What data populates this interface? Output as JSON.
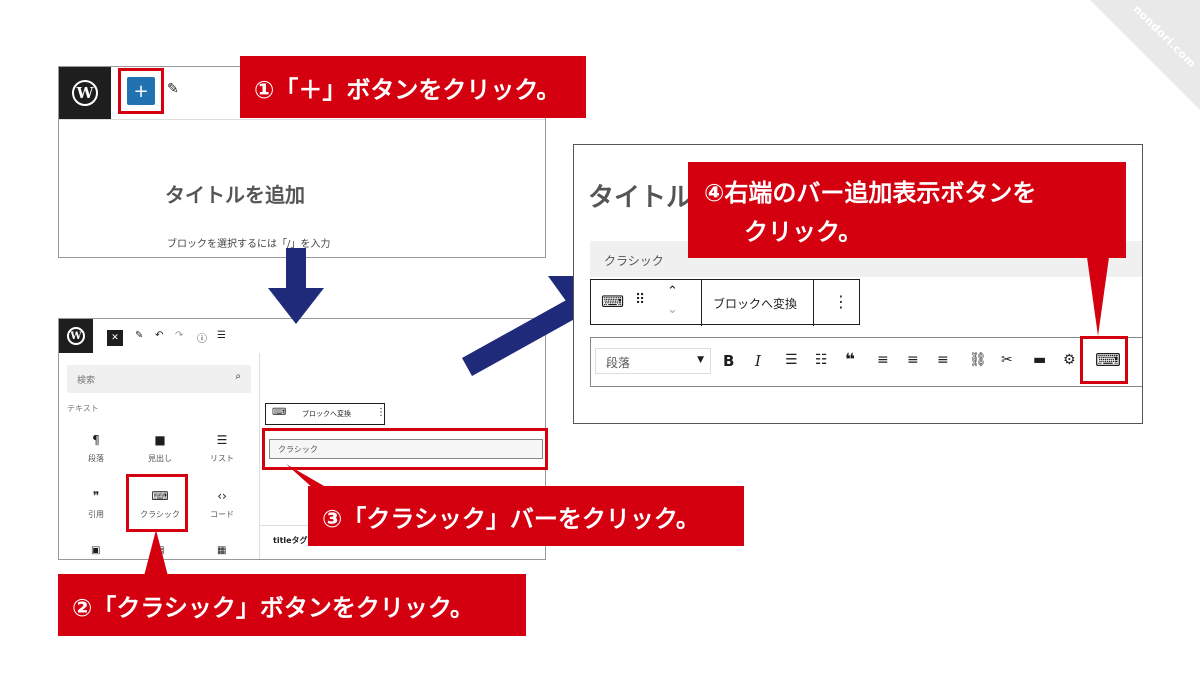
{
  "corner_badge": "nondori.com",
  "panel1": {
    "plus_label": "+",
    "title_placeholder": "タイトルを追加",
    "body_placeholder": "ブロックを選択するには「/」を入力"
  },
  "panel2": {
    "search_placeholder": "検索",
    "category": "テキスト",
    "blocks": [
      "段落",
      "見出し",
      "リスト",
      "引用",
      "クラシック",
      "コード"
    ],
    "transform_label": "ブロックへ変換",
    "classic_bar": "クラシック",
    "footer_text": "titleタグ"
  },
  "panel3": {
    "title_partial": "タイトル",
    "classic_bar": "クラシック",
    "transform_label": "ブロックへ変換",
    "format_select": "段落",
    "more_icon": "⋮"
  },
  "callouts": {
    "step1": "①「＋」ボタンをクリック。",
    "step2": "②「クラシック」ボタンをクリック。",
    "step3": "③「クラシック」バーをクリック。",
    "step4_line1": "④右端のバー追加表示ボタンを",
    "step4_line2": "クリック。"
  },
  "colors": {
    "callout_red": "#d4000f",
    "arrow_navy": "#1f2a7a",
    "wp_blue": "#2271b1"
  }
}
